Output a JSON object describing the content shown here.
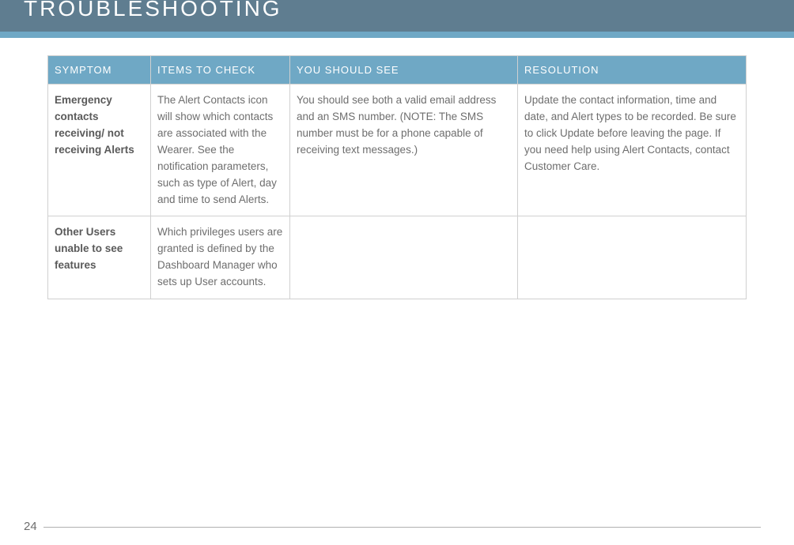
{
  "header": {
    "title": "TROUBLESHOOTING"
  },
  "table": {
    "headers": {
      "symptom": "SYMPTOM",
      "check": "ITEMS TO CHECK",
      "see": "YOU SHOULD SEE",
      "resolution": "RESOLUTION"
    },
    "rows": [
      {
        "symptom": "Emergency contacts receiving/ not receiving Alerts",
        "check": "The Alert Contacts icon will show which contacts are associated with the Wearer. See the notification parameters, such as type of Alert, day and time to send Alerts.",
        "see": "You should see both a valid email address and an SMS number. (NOTE: The SMS number must be for a phone capable of receiving text messages.)",
        "resolution": "Update the contact information, time and date, and Alert types to be recorded. Be sure to click Update before leaving the page. If you need help using Alert Contacts, contact Customer Care."
      },
      {
        "symptom": "Other Users unable to see features",
        "check": "Which privileges users are granted is defined by the Dashboard Manager who sets up User accounts.",
        "see": "",
        "resolution": ""
      }
    ]
  },
  "footer": {
    "page_number": "24"
  }
}
